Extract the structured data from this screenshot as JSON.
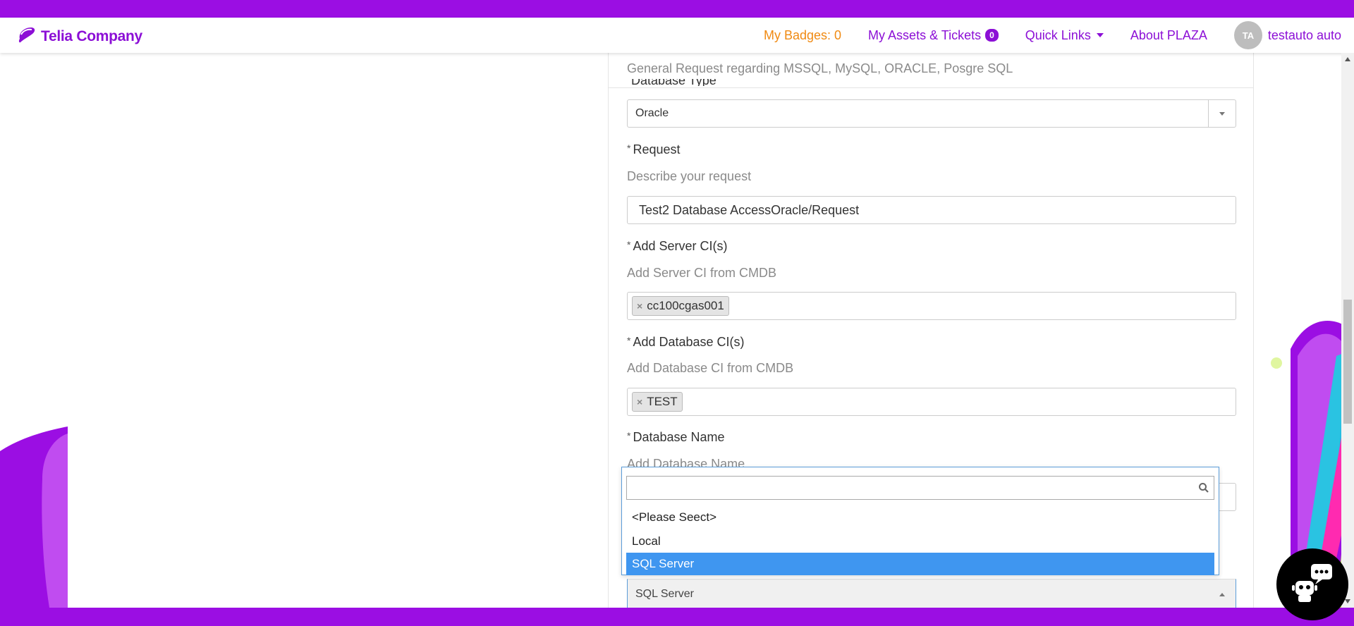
{
  "colors": {
    "brand": "#9b0ee3",
    "accent_orange": "#f08a12",
    "highlight_blue": "#3f96f0"
  },
  "header": {
    "logo_text": "Telia Company",
    "nav": {
      "badges": "My Badges: 0",
      "assets": "My Assets & Tickets",
      "assets_count": "0",
      "quick_links": "Quick Links",
      "about": "About PLAZA",
      "avatar_initials": "TA",
      "user_name": "testauto auto"
    }
  },
  "form": {
    "top_description": "General Request regarding MSSQL, MySQL, ORACLE, Posgre SQL",
    "cut_label": "Database Type",
    "database_type": {
      "value": "Oracle"
    },
    "request": {
      "label": "Request",
      "hint": "Describe your request",
      "value": "Test2 Database AccessOracle/Request"
    },
    "server_ci": {
      "label": "Add Server CI(s)",
      "hint": "Add Server CI from CMDB",
      "tags": [
        "cc100cgas001"
      ]
    },
    "database_ci": {
      "label": "Add Database CI(s)",
      "hint": "Add Database CI from CMDB",
      "tags": [
        "TEST"
      ]
    },
    "database_name": {
      "label": "Database Name",
      "hint": "Add Database Name"
    },
    "required_mark": "*",
    "remove_mark": "×"
  },
  "dropdown": {
    "search_value": "",
    "options": [
      "<Please Seect>",
      "Local",
      "SQL Server"
    ],
    "selected_index": 2,
    "current_value": "SQL Server"
  },
  "icons": [
    "telia-logo-icon",
    "search-icon",
    "chevron-down-icon",
    "chatbot-icon"
  ]
}
